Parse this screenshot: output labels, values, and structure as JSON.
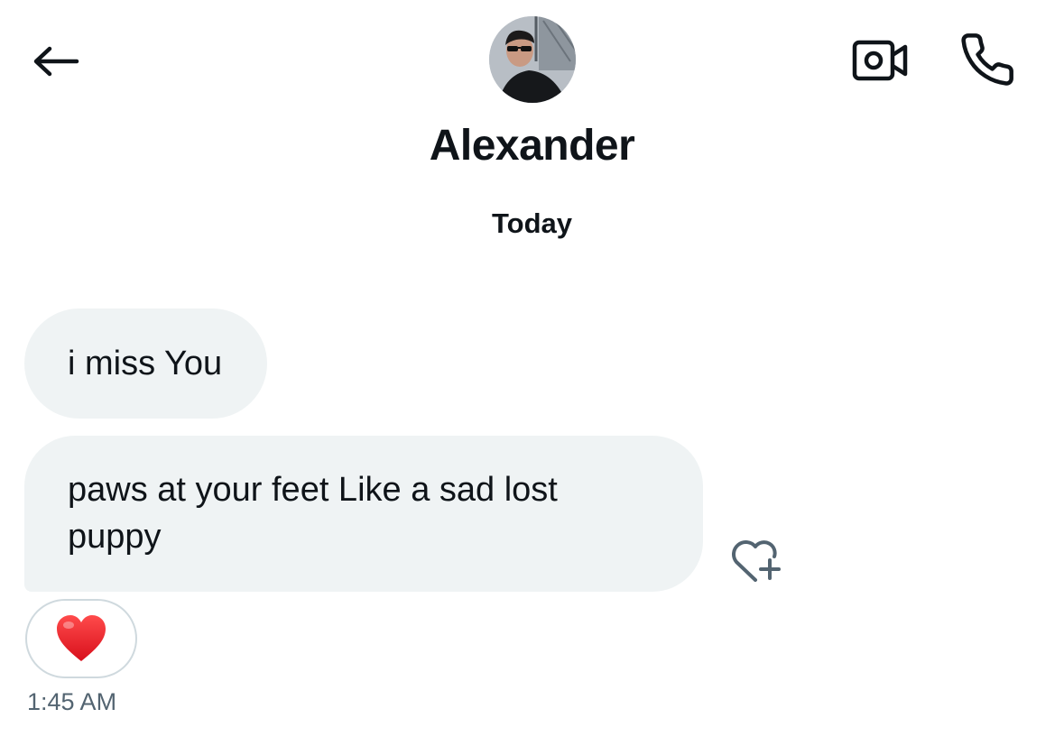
{
  "header": {
    "contact_name": "Alexander",
    "back_icon": "arrow-left-icon",
    "video_icon": "video-camera-icon",
    "call_icon": "phone-icon",
    "avatar_alt": "avatar photo"
  },
  "conversation": {
    "date_label": "Today",
    "messages": [
      {
        "text": "i miss You"
      },
      {
        "text": "paws at your feet Like a sad lost puppy"
      }
    ],
    "like_icon": "heart-plus-icon",
    "reaction": {
      "emoji": "❤️",
      "icon": "red-heart-icon"
    },
    "timestamp": "1:45 AM"
  },
  "colors": {
    "text_primary": "#0f1419",
    "text_secondary": "#536471",
    "bubble_bg": "#eff3f4",
    "pill_border": "#cfd9de",
    "reaction_heart": "#e0245e"
  }
}
